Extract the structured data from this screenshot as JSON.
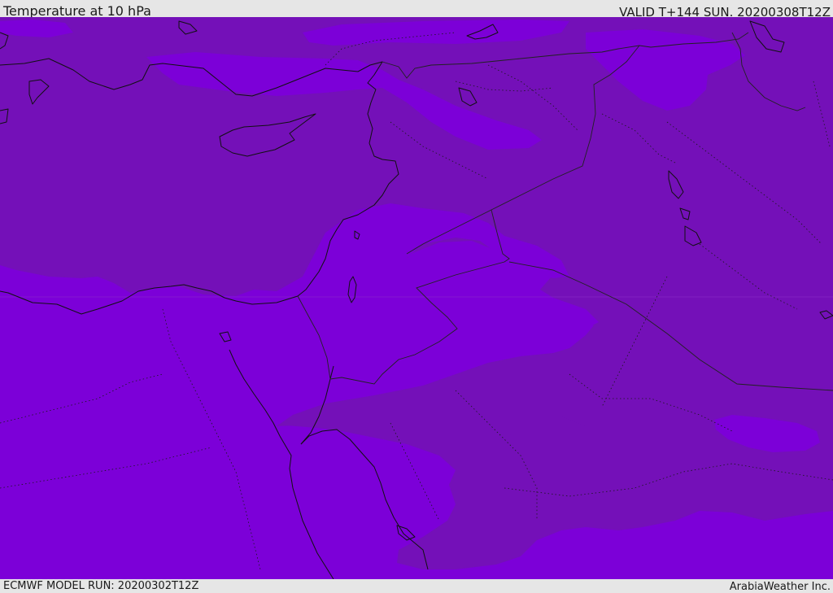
{
  "header": {
    "title": "Temperature at 10 hPa",
    "valid_time": "VALID T+144 SUN. 20200308T12Z"
  },
  "footer": {
    "model_run": "ECMWF MODEL RUN: 20200302T12Z",
    "credit": "ArabiaWeather Inc."
  },
  "map": {
    "variable": "Temperature",
    "pressure_level_hPa": 10,
    "colors": {
      "field_light": "#7c00d8",
      "field_dark": "#7410b8",
      "coastline": "#111111",
      "boundary": "#222222"
    }
  }
}
